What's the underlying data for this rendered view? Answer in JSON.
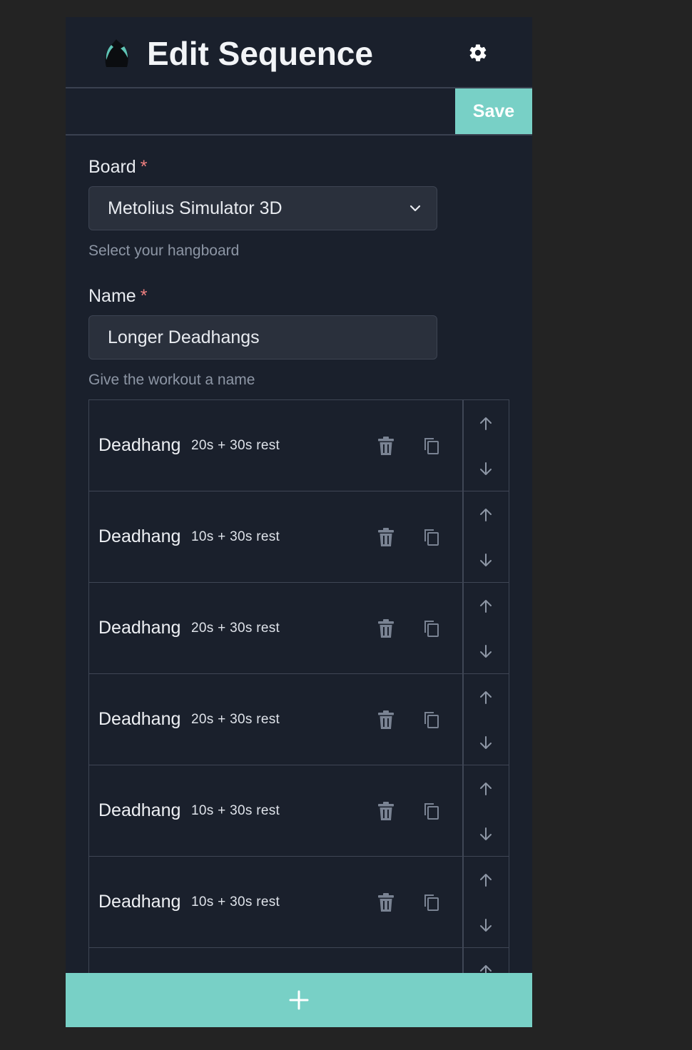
{
  "header": {
    "title": "Edit Sequence"
  },
  "toolbar": {
    "save_label": "Save"
  },
  "board": {
    "label": "Board",
    "required_mark": "*",
    "value": "Metolius Simulator 3D",
    "help": "Select your hangboard"
  },
  "name": {
    "label": "Name",
    "required_mark": "*",
    "value": "Longer Deadhangs",
    "help": "Give the workout a name"
  },
  "exercises": [
    {
      "name": "Deadhang",
      "detail": "20s + 30s rest"
    },
    {
      "name": "Deadhang",
      "detail": "10s + 30s rest"
    },
    {
      "name": "Deadhang",
      "detail": "20s + 30s rest"
    },
    {
      "name": "Deadhang",
      "detail": "20s + 30s rest"
    },
    {
      "name": "Deadhang",
      "detail": "10s + 30s rest"
    },
    {
      "name": "Deadhang",
      "detail": "10s + 30s rest"
    }
  ],
  "icons": {
    "logo": "climbing-hold-icon",
    "settings": "gear-icon",
    "select": "chevron-down-icon",
    "delete": "trash-icon",
    "duplicate": "copy-icon",
    "up": "arrow-up-icon",
    "down": "arrow-down-icon",
    "add": "plus-icon"
  },
  "colors": {
    "accent": "#78d0c6",
    "background": "#1a202c",
    "required": "#f08080"
  }
}
